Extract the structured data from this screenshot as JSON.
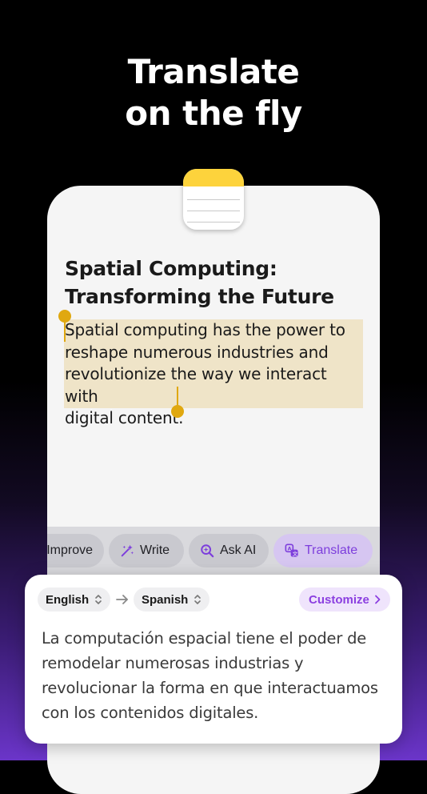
{
  "headline": {
    "line1": "Translate",
    "line2": "on the fly"
  },
  "note": {
    "title_line1": "Spatial Computing:",
    "title_line2": "Transforming the Future",
    "body_lines": [
      "Spatial computing has the power to",
      "reshape numerous industries and",
      "revolutionize the way we interact with",
      "digital content."
    ]
  },
  "toolbar": {
    "chips": [
      {
        "label": "Improve",
        "icon": "sparkle-icon"
      },
      {
        "label": "Write",
        "icon": "magic-wand-icon"
      },
      {
        "label": "Ask AI",
        "icon": "magnifier-sparkle-icon"
      },
      {
        "label": "Translate",
        "icon": "translate-icon",
        "active": true
      }
    ]
  },
  "translate_panel": {
    "source_language": "English",
    "target_language": "Spanish",
    "customize_label": "Customize",
    "translation_lines": [
      "La computación espacial tiene el poder de",
      "remodelar numerosas industrias y",
      "revolucionar la forma en que interactuamos",
      "con los contenidos digitales."
    ]
  },
  "colors": {
    "accent_purple": "#8b3fe0",
    "selection_highlight": "#efe4c8",
    "selection_handle": "#e0a810",
    "notes_yellow": "#fdd33c"
  }
}
